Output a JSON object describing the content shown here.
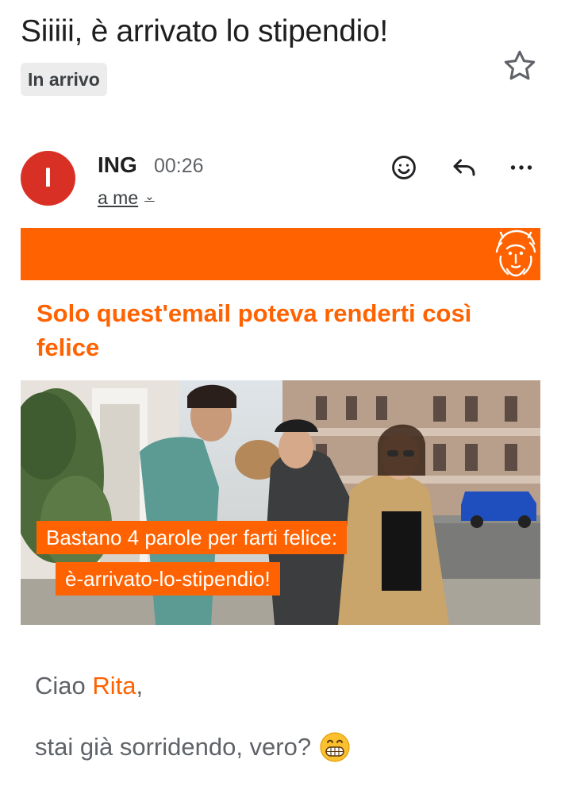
{
  "email": {
    "subject": "Siiiii, è arrivato lo stipendio!",
    "label": "In arrivo",
    "sender": {
      "name": "ING",
      "avatar_letter": "I",
      "time": "00:26",
      "recipient": "a me"
    },
    "actions": {
      "emoji_icon": "add-reaction-icon",
      "reply_icon": "reply-icon",
      "more_icon": "more-horizontal-icon"
    }
  },
  "content": {
    "headline": "Solo quest'email poteva renderti così felice",
    "promo_line_1": "Bastano 4 parole per farti felice:",
    "promo_line_2": "è-arrivato-lo-stipendio!",
    "greeting_prefix": "Ciao ",
    "greeting_name": "Rita",
    "greeting_suffix": ",",
    "line_2": "stai già sorridendo, vero?"
  },
  "colors": {
    "brand_orange": "#ff6200",
    "avatar_red": "#d93025",
    "text_grey": "#5f6368"
  }
}
